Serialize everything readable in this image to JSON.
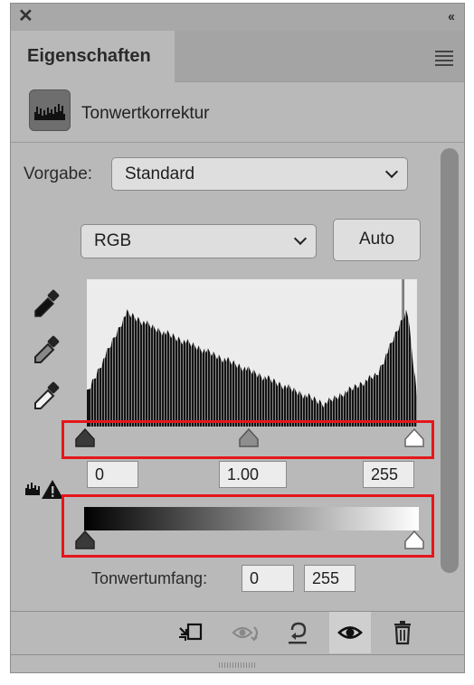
{
  "panel": {
    "tab_title": "Eigenschaften",
    "layer_title": "Tonwertkorrektur"
  },
  "icons": {
    "close": "close-icon",
    "collapse": "double-chevron-icon",
    "menu": "panel-menu-icon",
    "layer": "levels-histogram-icon",
    "black_eyedropper": "black-point-eyedropper-icon",
    "gray_eyedropper": "gray-point-eyedropper-icon",
    "white_eyedropper": "white-point-eyedropper-icon",
    "clipping_warning": "histogram-warning-icon"
  },
  "preset": {
    "label": "Vorgabe:",
    "value": "Standard"
  },
  "channel": {
    "value": "RGB"
  },
  "auto_button": "Auto",
  "input_levels": {
    "black": "0",
    "gamma": "1.00",
    "white": "255"
  },
  "output_levels": {
    "label": "Tonwertumfang:",
    "black": "0",
    "white": "255"
  },
  "footer": {
    "icons": [
      "clip-to-layer-icon",
      "view-previous-state-icon",
      "reset-icon",
      "visibility-icon",
      "delete-icon"
    ]
  },
  "colors": {
    "highlight_box": "#e5161b",
    "panel_bg": "#b9b9b9",
    "histogram_bg": "#ececec"
  }
}
